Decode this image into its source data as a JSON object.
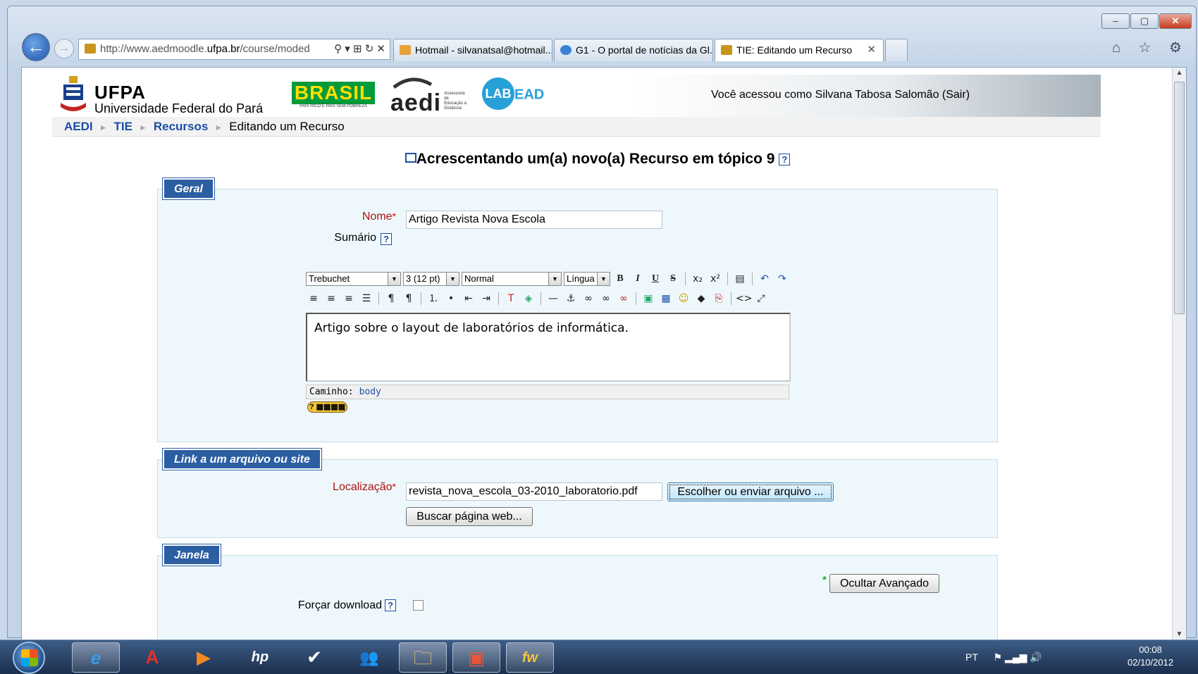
{
  "browser": {
    "address": {
      "prefix": "http://www.aedmoodle.",
      "domain": "ufpa.br",
      "suffix": "/course/moded"
    },
    "address_icons": "⚲ ▾  ⊞ ↻ ✕",
    "tabs": [
      {
        "label": "Hotmail - silvanatsal@hotmail...",
        "color": "#e8a23a"
      },
      {
        "label": "G1 - O portal de notícias da Gl...",
        "color": "#3a82d6"
      },
      {
        "label": "TIE: Editando um Recurso",
        "color": "#c8951c"
      }
    ],
    "right_icons": "⌂ ☆ ⚙",
    "window_buttons": {
      "min": "–",
      "max": "▢",
      "close": "✕"
    }
  },
  "header": {
    "logo_title": "UFPA",
    "logo_subtitle": "Universidade Federal do Pará",
    "brasil": "BRASIL",
    "brasil_sub": "PAÍS RICO É PAÍS SEM POBREZA",
    "aedi": "aedi",
    "aedi_sub": "Assessoria de Educação a Distância",
    "labead_a": "LAB",
    "labead_b": "EAD",
    "user_info": "Você acessou como Silvana Tabosa Salomão (Sair)"
  },
  "breadcrumb": {
    "items": [
      "AEDI",
      "TIE",
      "Recursos"
    ],
    "current": "Editando um Recurso",
    "sep": "►"
  },
  "page_title": "Acrescentando um(a) novo(a) Recurso em tópico 9",
  "help_glyph": "?",
  "geral": {
    "legend": "Geral",
    "nome_label": "Nome",
    "nome_value": "Artigo Revista Nova Escola",
    "sumario_label": "Sumário"
  },
  "editor": {
    "font": "Trebuchet",
    "size": "3 (12 pt)",
    "format": "Normal",
    "lang": "Língua",
    "content": "Artigo sobre o layout de laboratórios de informática.",
    "path_label": "Caminho:",
    "path_value": "body",
    "help_badge": "? ▦▦▦▦"
  },
  "link": {
    "legend": "Link a um arquivo ou site",
    "loc_label": "Localização",
    "loc_value": "revista_nova_escola_03-2010_laboratorio.pdf",
    "choose_button": "Escolher ou enviar arquivo ...",
    "search_button": "Buscar página web..."
  },
  "janela": {
    "legend": "Janela",
    "advanced_button": "Ocultar Avançado",
    "advanced_star": "*",
    "force_download": "Forçar download"
  },
  "taskbar": {
    "apps": [
      {
        "icon": "e",
        "name": "internet-explorer"
      },
      {
        "icon": "A",
        "name": "avira"
      },
      {
        "icon": "▶",
        "name": "media-player"
      },
      {
        "icon": "hp",
        "name": "hp"
      },
      {
        "icon": "✔",
        "name": "checkmark-app"
      },
      {
        "icon": "👥",
        "name": "contacts"
      },
      {
        "icon": "🗀",
        "name": "explorer"
      },
      {
        "icon": "▣",
        "name": "presentation"
      },
      {
        "icon": "fw",
        "name": "fw-app"
      }
    ],
    "lang": "PT",
    "tray_icons": "⚑ ▂▄▆ 🔊",
    "time": "00:08",
    "date": "02/10/2012"
  }
}
